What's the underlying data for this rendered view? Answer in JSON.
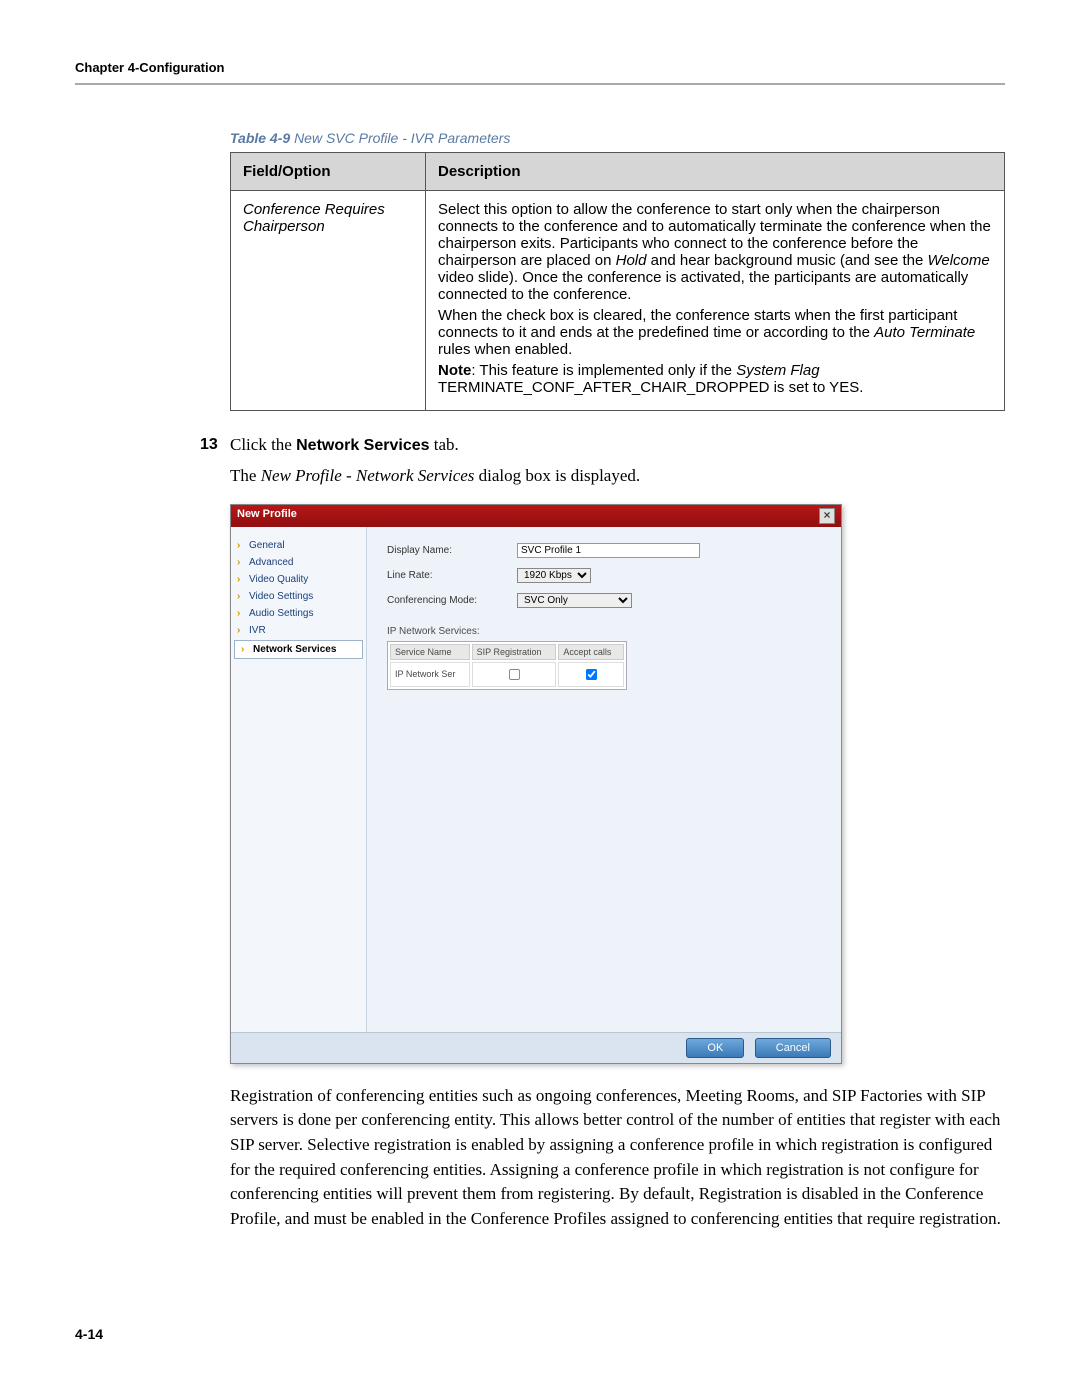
{
  "header": {
    "chapter": "Chapter 4-Configuration"
  },
  "table_caption": {
    "label": "Table 4-9",
    "title": "New SVC Profile - IVR Parameters"
  },
  "ivr_table": {
    "headers": {
      "field": "Field/Option",
      "desc": "Description"
    },
    "row": {
      "field": "Conference Requires Chairperson",
      "p1a": "Select this option to allow the conference to start only when the chairperson connects to the conference and to automatically terminate the conference when the chairperson exits. Participants who connect to the conference before the chairperson are placed on ",
      "p1_hold": "Hold",
      "p1b": " and hear background music (and see the ",
      "p1_welcome": "Welcome",
      "p1c": " video slide). Once the conference is activated, the participants are automatically connected to the conference.",
      "p2a": "When the check box is cleared, the conference starts when the first participant connects to it and ends at the predefined time or according to the ",
      "p2_auto": "Auto Terminate",
      "p2b": " rules when enabled.",
      "p3_note": "Note",
      "p3a": ": This feature is implemented only if the ",
      "p3_flag": "System Flag",
      "p3b": " TERMINATE_CONF_AFTER_CHAIR_DROPPED is set to YES."
    }
  },
  "step": {
    "num": "13",
    "pre": "Click the ",
    "bold": "Network Services",
    "post": " tab."
  },
  "sub": {
    "pre": "The ",
    "italic": "New Profile - Network Services",
    "post": " dialog box is displayed."
  },
  "dialog": {
    "title": "New Profile",
    "sidebar": {
      "items": [
        "General",
        "Advanced",
        "Video Quality",
        "Video Settings",
        "Audio Settings",
        "IVR",
        "Network Services"
      ],
      "selected_index": 6
    },
    "fields": {
      "display_name": {
        "label": "Display Name:",
        "value": "SVC Profile 1"
      },
      "line_rate": {
        "label": "Line Rate:",
        "value": "1920 Kbps"
      },
      "conf_mode": {
        "label": "Conferencing Mode:",
        "value": "SVC Only"
      },
      "ip_section": "IP Network Services:"
    },
    "ip_table": {
      "headers": [
        "Service Name",
        "SIP Registration",
        "Accept calls"
      ],
      "row": {
        "name": "IP Network Ser",
        "sip": false,
        "accept": true
      }
    },
    "buttons": {
      "ok": "OK",
      "cancel": "Cancel"
    }
  },
  "paragraph": "Registration of conferencing entities such as ongoing conferences, Meeting Rooms, and SIP Factories with SIP servers is done per conferencing entity. This allows better control of the number of entities that register with each SIP server. Selective registration is enabled by assigning a conference profile in which registration is configured for the required conferencing entities. Assigning a conference profile in which registration is not configure for conferencing entities will prevent them from registering. By default, Registration is disabled in the Conference Profile, and must be enabled in the Conference Profiles assigned to conferencing entities that require registration.",
  "footer": {
    "page": "4-14"
  }
}
